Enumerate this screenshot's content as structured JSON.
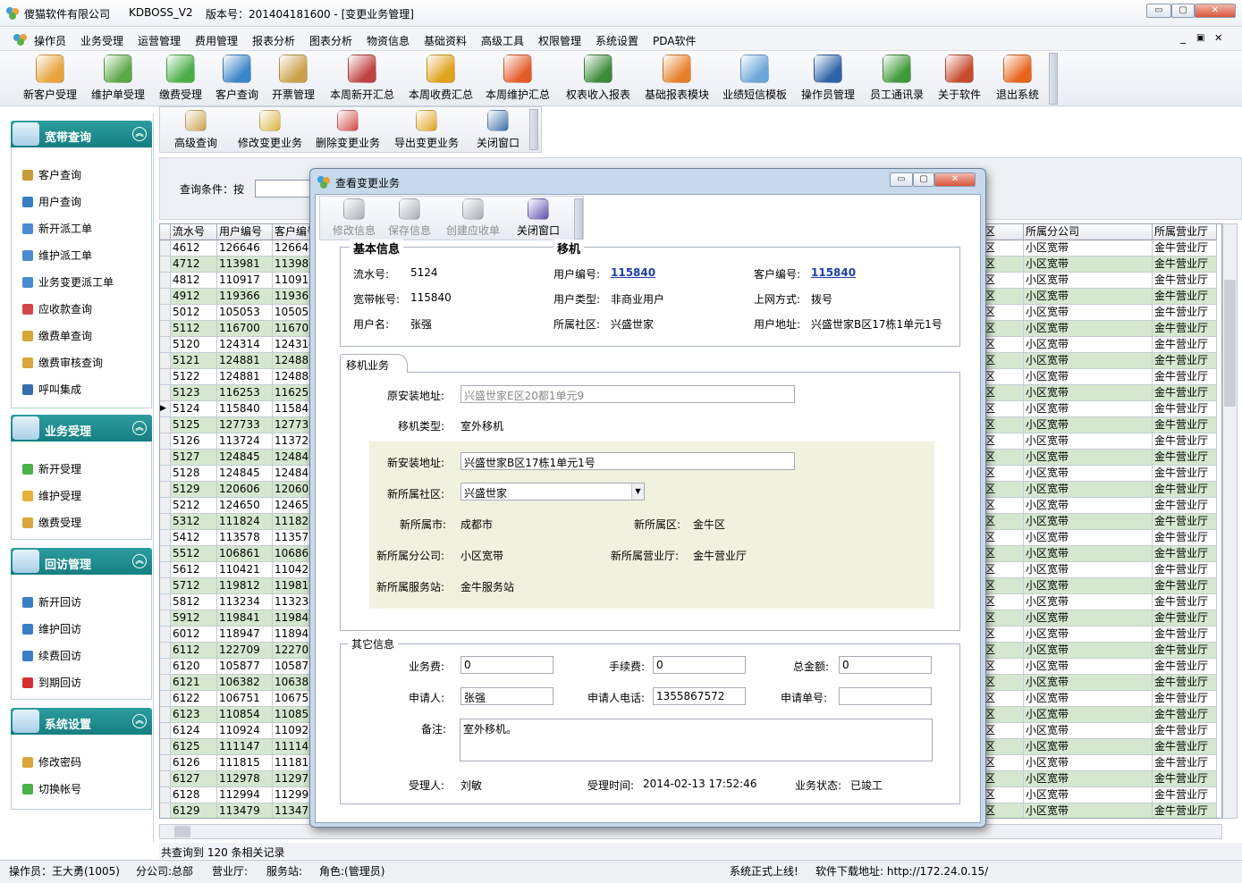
{
  "window": {
    "company": "傻猫软件有限公司",
    "app": "KDBOSS_V2",
    "version": "版本号：201404181600 - [变更业务管理]",
    "min": "▭",
    "max": "▢",
    "close": "✕"
  },
  "menu": [
    "操作员",
    "业务受理",
    "运营管理",
    "费用管理",
    "报表分析",
    "图表分析",
    "物资信息",
    "基础资料",
    "高级工具",
    "权限管理",
    "系统设置",
    "PDA软件"
  ],
  "menu_ctrl": {
    "min": "_",
    "restore": "▣",
    "close": "✕"
  },
  "toolbar": [
    {
      "label": "新客户受理",
      "color": "#e8a33a"
    },
    {
      "label": "维护单受理",
      "color": "#5aa846"
    },
    {
      "label": "缴费受理",
      "color": "#4cb04a"
    },
    {
      "label": "客户查询",
      "color": "#3a86c8"
    },
    {
      "label": "开票管理",
      "color": "#c9a24b"
    },
    {
      "label": "本周新开汇总",
      "color": "#c04343"
    },
    {
      "label": "本周收费汇总",
      "color": "#e0a21c"
    },
    {
      "label": "本周维护汇总",
      "color": "#e35d2a"
    },
    {
      "label": "权表收入报表",
      "color": "#3c8b3a"
    },
    {
      "label": "基础报表模块",
      "color": "#e7802a"
    },
    {
      "label": "业绩短信模板",
      "color": "#6aa6d8"
    },
    {
      "label": "操作员管理",
      "color": "#2d63a8"
    },
    {
      "label": "员工通讯录",
      "color": "#3f9a3a"
    },
    {
      "label": "关于软件",
      "color": "#c84a2e"
    },
    {
      "label": "退出系统",
      "color": "#e8641c"
    }
  ],
  "groups": [
    {
      "title": "宽带查询",
      "items": [
        {
          "label": "客户查询",
          "color": "#c79a3a"
        },
        {
          "label": "用户查询",
          "color": "#3a7fc4"
        },
        {
          "label": "新开派工单",
          "color": "#4a8ad0"
        },
        {
          "label": "维护派工单",
          "color": "#4a8ad0"
        },
        {
          "label": "业务变更派工单",
          "color": "#4a8ad0"
        },
        {
          "label": "应收款查询",
          "color": "#d64545"
        },
        {
          "label": "缴费单查询",
          "color": "#d8a63a"
        },
        {
          "label": "缴费审核查询",
          "color": "#d8a63a"
        },
        {
          "label": "呼叫集成",
          "color": "#3a6ea8"
        }
      ]
    },
    {
      "title": "业务受理",
      "items": [
        {
          "label": "新开受理",
          "color": "#4ab04a"
        },
        {
          "label": "维护受理",
          "color": "#e8b03a"
        },
        {
          "label": "缴费受理",
          "color": "#d8a63a"
        }
      ]
    },
    {
      "title": "回访管理",
      "items": [
        {
          "label": "新开回访",
          "color": "#3a7fc4"
        },
        {
          "label": "维护回访",
          "color": "#3a7fc4"
        },
        {
          "label": "续费回访",
          "color": "#3a7fc4"
        },
        {
          "label": "到期回访",
          "color": "#d63030"
        }
      ]
    },
    {
      "title": "系统设置",
      "items": [
        {
          "label": "修改密码",
          "color": "#d8a63a"
        },
        {
          "label": "切换帐号",
          "color": "#4ab04a"
        }
      ]
    }
  ],
  "subtoolbar": [
    "高级查询",
    "修改变更业务",
    "删除变更业务",
    "导出变更业务",
    "关闭窗口"
  ],
  "query": {
    "label": "查询条件：按"
  },
  "grid": {
    "headers": [
      "流水号",
      "用户编号",
      "客户编号",
      "区",
      "所属分公司",
      "所属营业厅"
    ],
    "rows": [
      [
        "4612",
        "126646",
        "126646"
      ],
      [
        "4712",
        "113981",
        "113981"
      ],
      [
        "4812",
        "110917",
        "110917"
      ],
      [
        "4912",
        "119366",
        "119366"
      ],
      [
        "5012",
        "105053",
        "105053"
      ],
      [
        "5112",
        "116700",
        "116700"
      ],
      [
        "5120",
        "124314",
        "124314"
      ],
      [
        "5121",
        "124881",
        "124881"
      ],
      [
        "5122",
        "124881",
        "124881"
      ],
      [
        "5123",
        "116253",
        "116253"
      ],
      [
        "5124",
        "115840",
        "115840"
      ],
      [
        "5125",
        "127733",
        "127733"
      ],
      [
        "5126",
        "113724",
        "113724"
      ],
      [
        "5127",
        "124845",
        "124845"
      ],
      [
        "5128",
        "124845",
        "124845"
      ],
      [
        "5129",
        "120606",
        "120606"
      ],
      [
        "5212",
        "124650",
        "124650"
      ],
      [
        "5312",
        "111824",
        "111824"
      ],
      [
        "5412",
        "113578",
        "113578"
      ],
      [
        "5512",
        "106861",
        "106861"
      ],
      [
        "5612",
        "110421",
        "110421"
      ],
      [
        "5712",
        "119812",
        "119812"
      ],
      [
        "5812",
        "113234",
        "113234"
      ],
      [
        "5912",
        "119841",
        "119841"
      ],
      [
        "6012",
        "118947",
        "118947"
      ],
      [
        "6112",
        "122709",
        "122709"
      ],
      [
        "6120",
        "105877",
        "105877"
      ],
      [
        "6121",
        "106382",
        "106382"
      ],
      [
        "6122",
        "106751",
        "106751"
      ],
      [
        "6123",
        "110854",
        "110854"
      ],
      [
        "6124",
        "110924",
        "110924"
      ],
      [
        "6125",
        "111147",
        "111147"
      ],
      [
        "6126",
        "111815",
        "111815"
      ],
      [
        "6127",
        "112978",
        "112978"
      ],
      [
        "6128",
        "112994",
        "112994"
      ],
      [
        "6129",
        "113479",
        "113479"
      ]
    ],
    "right_cols": [
      "区",
      "小区宽带",
      "金牛营业厅"
    ],
    "selected_index": 10,
    "selected_marker": "▶",
    "odd_color": "#d5e8cf"
  },
  "count_text": "共查询到 120 条相关记录",
  "status": {
    "operator": "操作员：王大勇(1005)",
    "branch": "分公司:总部",
    "hall": "营业厅:",
    "station": "服务站:",
    "role": "角色:(管理员)",
    "notice": "系统正式上线!",
    "download": "软件下载地址:  http://172.24.0.15/"
  },
  "dialog": {
    "title": "查看变更业务",
    "toolbar": [
      "修改信息",
      "保存信息",
      "创建应收单",
      "关闭窗口"
    ],
    "basic_title": "基本信息",
    "move_title": "移机",
    "basic": {
      "serial_label": "流水号:",
      "serial": "5124",
      "user_no_label": "用户编号:",
      "user_no": "115840",
      "cust_no_label": "客户编号:",
      "cust_no": "115840",
      "account_label": "宽带帐号:",
      "account": "115840",
      "user_type_label": "用户类型:",
      "user_type": "非商业用户",
      "net_label": "上网方式:",
      "net": "拨号",
      "name_label": "用户名:",
      "name": "张强",
      "community_label": "所属社区:",
      "community": "兴盛世家",
      "addr_label": "用户地址:",
      "addr": "兴盛世家B区17栋1单元1号"
    },
    "tab": "移机业务",
    "move": {
      "old_addr_label": "原安装地址:",
      "old_addr": "兴盛世家E区20都1单元9",
      "type_label": "移机类型:",
      "type": "室外移机",
      "new_addr_label": "新安装地址:",
      "new_addr": "兴盛世家B区17栋1单元1号",
      "new_comm_label": "新所属社区:",
      "new_comm": "兴盛世家",
      "new_city_label": "新所属市:",
      "new_city": "成都市",
      "new_district_label": "新所属区:",
      "new_district": "金牛区",
      "new_branch_label": "新所属分公司:",
      "new_branch": "小区宽带",
      "new_hall_label": "新所属营业厅:",
      "new_hall": "金牛营业厅",
      "new_station_label": "新所属服务站:",
      "new_station": "金牛服务站"
    },
    "other_title": "其它信息",
    "other": {
      "fee_label": "业务费:",
      "fee": "0",
      "handle_label": "手续费:",
      "handle": "0",
      "total_label": "总金额:",
      "total": "0",
      "applicant_label": "申请人:",
      "applicant": "张强",
      "phone_label": "申请人电话:",
      "phone": "1355867572",
      "apply_no_label": "申请单号:",
      "apply_no": "",
      "remark_label": "备注:",
      "remark": "室外移机。",
      "receiver_label": "受理人:",
      "receiver": "刘敏",
      "time_label": "受理时间:",
      "time": "2014-02-13 17:52:46",
      "state_label": "业务状态:",
      "state": "已竣工"
    }
  }
}
